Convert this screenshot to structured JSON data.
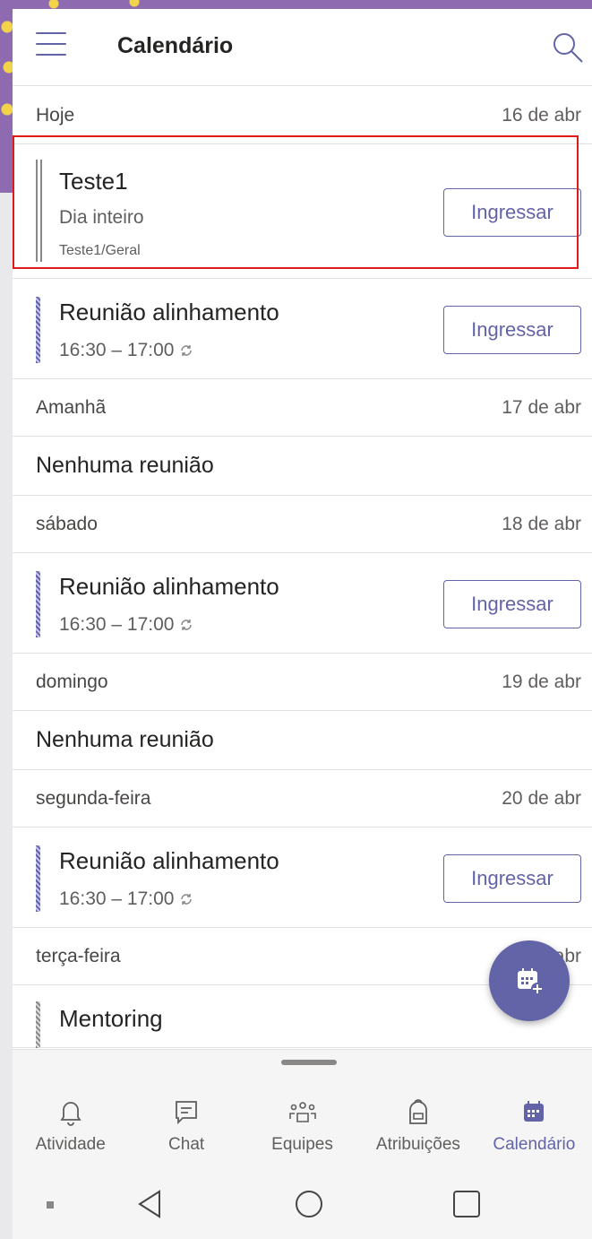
{
  "header": {
    "title": "Calendário",
    "menu_icon": "hamburger-menu-icon",
    "search_icon": "search-icon"
  },
  "days": [
    {
      "label": "Hoje",
      "date": "16 de abr",
      "events": [
        {
          "title": "Teste1",
          "subtitle": "Dia inteiro",
          "channel": "Teste1/Geral",
          "join": "Ingressar"
        },
        {
          "title": "Reunião alinhamento",
          "time": "16:30 – 17:00",
          "join": "Ingressar",
          "recurring_icon": "recurring-icon"
        }
      ]
    },
    {
      "label": "Amanhã",
      "date": "17 de abr",
      "no_meeting": "Nenhuma reunião"
    },
    {
      "label": "sábado",
      "date": "18 de abr",
      "events": [
        {
          "title": "Reunião alinhamento",
          "time": "16:30 – 17:00",
          "join": "Ingressar"
        }
      ]
    },
    {
      "label": "domingo",
      "date": "19 de abr",
      "no_meeting": "Nenhuma reunião"
    },
    {
      "label": "segunda-feira",
      "date": "20 de abr",
      "events": [
        {
          "title": "Reunião alinhamento",
          "time": "16:30 – 17:00",
          "join": "Ingressar"
        }
      ]
    },
    {
      "label": "terça-feira",
      "date": "21 de abr",
      "events": [
        {
          "title": "Mentoring"
        }
      ]
    }
  ],
  "fab": {
    "icon": "new-meeting-calendar-icon"
  },
  "nav": [
    {
      "label": "Atividade",
      "icon": "bell-icon",
      "active": false
    },
    {
      "label": "Chat",
      "icon": "chat-icon",
      "active": false
    },
    {
      "label": "Equipes",
      "icon": "teams-icon",
      "active": false
    },
    {
      "label": "Atribuições",
      "icon": "backpack-icon",
      "active": false
    },
    {
      "label": "Calendário",
      "icon": "calendar-icon",
      "active": true
    }
  ],
  "colors": {
    "accent": "#6264a7",
    "highlight": "#e0191a"
  }
}
